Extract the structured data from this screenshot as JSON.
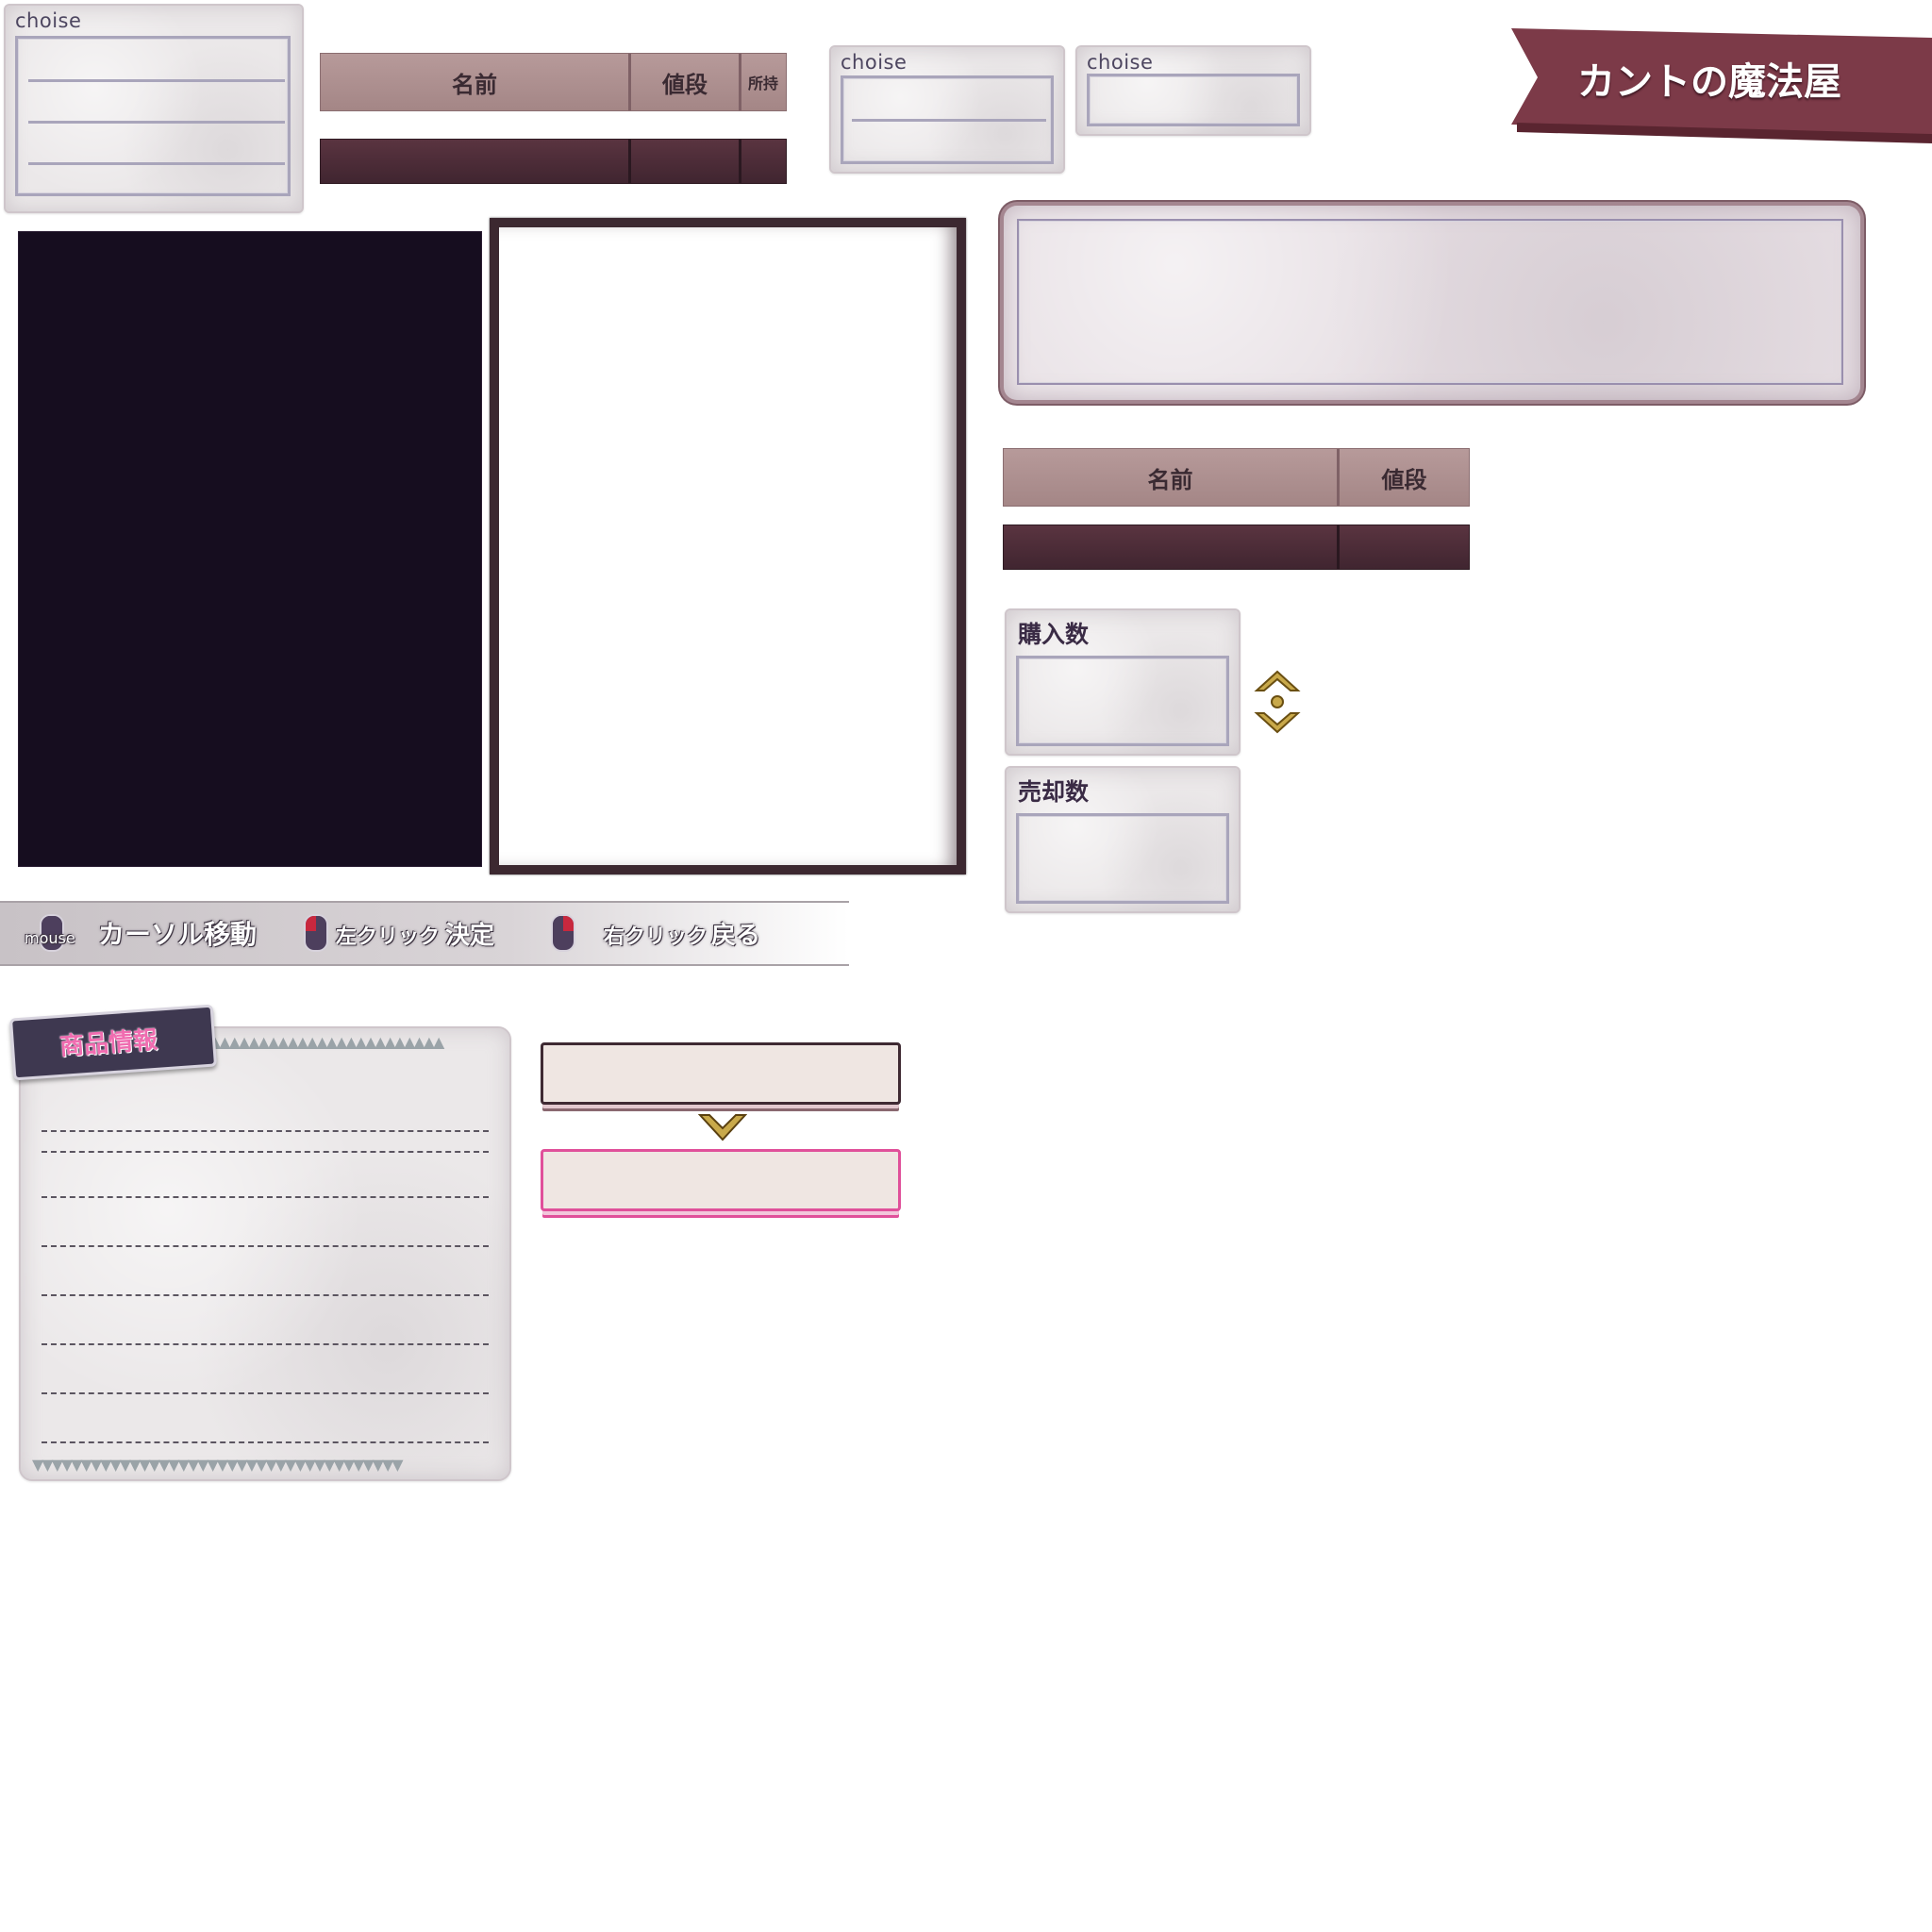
{
  "choice_windows": {
    "large_label": "choise",
    "medium_label": "choise",
    "small_label": "choise"
  },
  "item_table_3col": {
    "col_name": "名前",
    "col_price": "値段",
    "col_owned": "所持"
  },
  "item_table_2col": {
    "col_name": "名前",
    "col_price": "値段"
  },
  "shop_banner": {
    "title": "カントの魔法屋",
    "ribbon_color": "#7c3a48"
  },
  "quantity_boxes": {
    "buy_label": "購入数",
    "sell_label": "売却数"
  },
  "controls_bar": {
    "mouse_caption": "mouse",
    "cursor_move": "カーソル移動",
    "left_click": "左クリック",
    "confirm": "決定",
    "right_click": "右クリック",
    "back": "戻る",
    "hot_button_color": "#c8283e"
  },
  "product_info": {
    "tab_label": "商品情報",
    "tab_text_color": "#f06cb0"
  },
  "icons": {
    "up_down_arrows": "chevron-updown-icon",
    "down_chevron": "chevron-down-icon"
  }
}
